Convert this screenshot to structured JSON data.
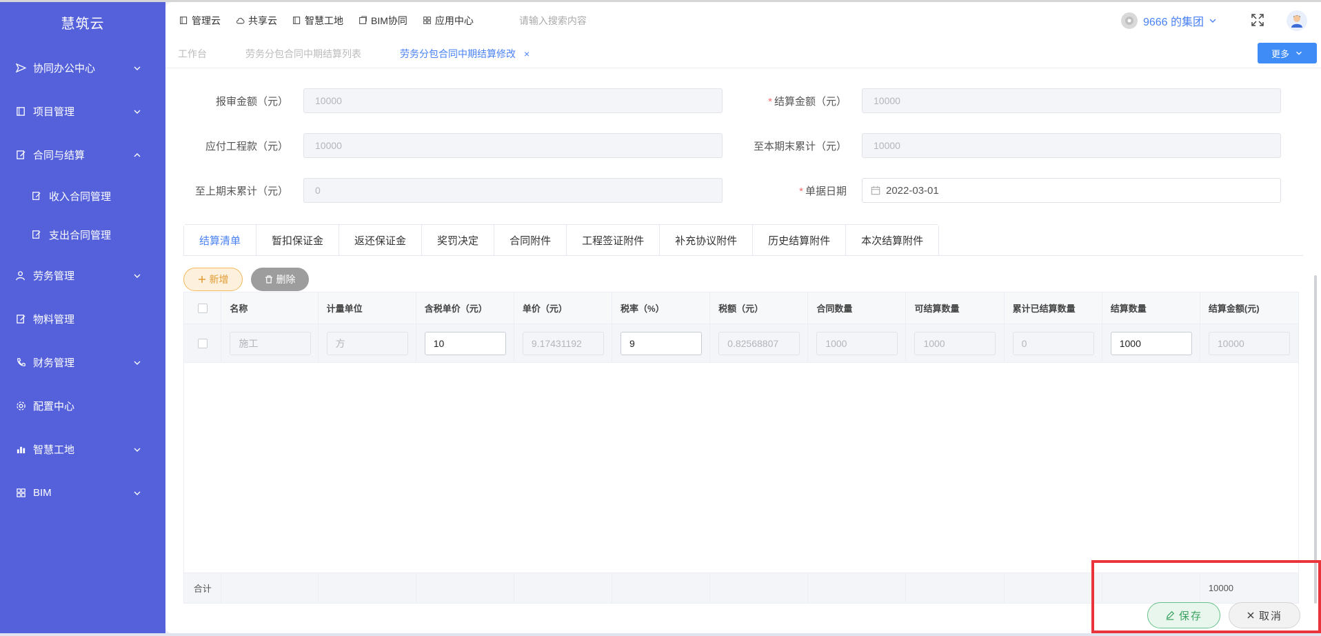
{
  "sidebar": {
    "brand": "慧筑云",
    "items": [
      {
        "label": "协同办公中心",
        "icon": "send-icon",
        "chevron": "down"
      },
      {
        "label": "项目管理",
        "icon": "book-icon",
        "chevron": "down"
      },
      {
        "label": "合同与结算",
        "icon": "edit-icon",
        "chevron": "up"
      },
      {
        "label": "收入合同管理",
        "icon": "edit-icon",
        "sub": true
      },
      {
        "label": "支出合同管理",
        "icon": "edit-icon",
        "sub": true
      },
      {
        "label": "劳务管理",
        "icon": "user-icon",
        "chevron": "down"
      },
      {
        "label": "物料管理",
        "icon": "edit-icon"
      },
      {
        "label": "财务管理",
        "icon": "phone-icon",
        "chevron": "down"
      },
      {
        "label": "配置中心",
        "icon": "gear-icon"
      },
      {
        "label": "智慧工地",
        "icon": "bar-chart-icon",
        "chevron": "down"
      },
      {
        "label": "BIM",
        "icon": "grid-icon",
        "chevron": "down"
      }
    ]
  },
  "topnav": {
    "links": [
      "管理云",
      "共享云",
      "智慧工地",
      "BIM协同",
      "应用中心"
    ],
    "search_placeholder": "请输入搜索内容",
    "org": "9666 的集团"
  },
  "pagetabs": {
    "tabs": [
      "工作台",
      "劳务分包合同中期结算列表",
      "劳务分包合同中期结算修改"
    ],
    "more": "更多"
  },
  "form": {
    "report_amount": {
      "label": "报审金额（元）",
      "value": "10000"
    },
    "settle_amount": {
      "label": "结算金额（元）",
      "value": "10000"
    },
    "payable": {
      "label": "应付工程款（元）",
      "value": "10000"
    },
    "cumulative_current": {
      "label": "至本期末累计（元）",
      "value": "10000"
    },
    "cumulative_prev": {
      "label": "至上期末累计（元）",
      "value": "0"
    },
    "doc_date": {
      "label": "单据日期",
      "value": "2022-03-01"
    }
  },
  "detail_tabs": [
    "结算清单",
    "暂扣保证金",
    "返还保证金",
    "奖罚决定",
    "合同附件",
    "工程签证附件",
    "补充协议附件",
    "历史结算附件",
    "本次结算附件"
  ],
  "actions": {
    "add": "新增",
    "delete": "删除"
  },
  "table": {
    "columns": [
      "名称",
      "计量单位",
      "含税单价（元）",
      "单价（元）",
      "税率（%）",
      "税额（元）",
      "合同数量",
      "可结算数量",
      "累计已结算数量",
      "结算数量",
      "结算金额(元)"
    ],
    "row": [
      "施工",
      "方",
      "10",
      "9.17431192",
      "9",
      "0.82568807",
      "1000",
      "1000",
      "0",
      "1000",
      "10000"
    ],
    "footer_label": "合计",
    "footer_total": "10000"
  },
  "buttons": {
    "save": "保存",
    "cancel": "取消"
  },
  "colors": {
    "sidebar": "#5461da",
    "accent": "#4a82f5",
    "highlight": "#e8343a"
  }
}
